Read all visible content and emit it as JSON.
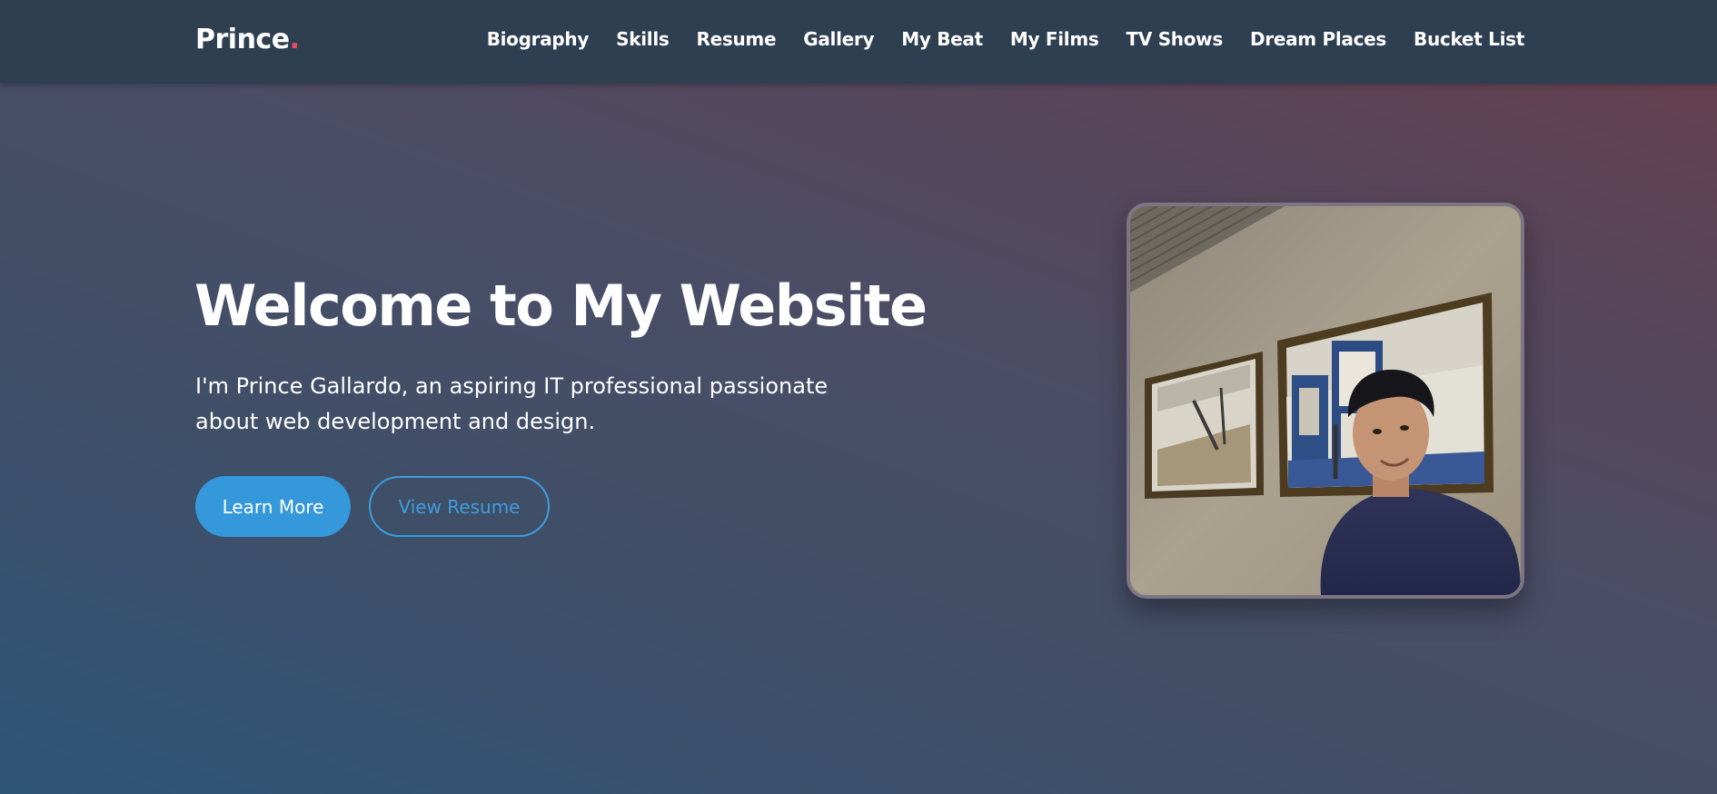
{
  "brand": {
    "name": "Prince",
    "dot": ".",
    "dot_color": "#e74c5c"
  },
  "nav": {
    "items": [
      {
        "label": "Biography"
      },
      {
        "label": "Skills"
      },
      {
        "label": "Resume"
      },
      {
        "label": "Gallery"
      },
      {
        "label": "My Beat"
      },
      {
        "label": "My Films"
      },
      {
        "label": "TV Shows"
      },
      {
        "label": "Dream Places"
      },
      {
        "label": "Bucket List"
      }
    ]
  },
  "hero": {
    "title": "Welcome to My Website",
    "intro": "I'm Prince Gallardo, an aspiring IT professional passionate about web development and design.",
    "primary_button": "Learn More",
    "secondary_button": "View Resume",
    "accent_color": "#3498db"
  },
  "profile_photo": {
    "icon": "profile-photo"
  }
}
